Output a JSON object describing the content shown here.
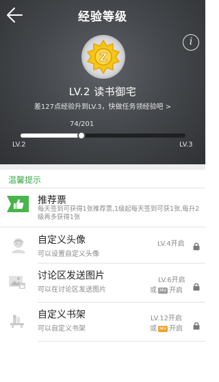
{
  "header": {
    "title": "经验等级",
    "level_name": "LV.2 读书御宅",
    "hint": "差127点经验升到LV.3，快做任务领经验吧 >",
    "progress": {
      "current": 74,
      "total": 201,
      "label": "74/201"
    },
    "from_level": "LV.2",
    "to_level": "LV.3",
    "badge_letter": "Z",
    "info_label": "i"
  },
  "section": {
    "label": "温馨提示"
  },
  "items": [
    {
      "title": "推荐票",
      "desc": "每天签到可获得1张推荐票,1级起每天签到可获1张,每升2级再多获得1张",
      "icon": "thumbs-up-flag-icon"
    },
    {
      "title": "自定义头像",
      "sub": "可以设置自定义头像",
      "unlock_line1": "LV.4开启",
      "icon": "avatar-icon"
    },
    {
      "title": "讨论区发送图片",
      "sub": "可以在讨论区发送图片",
      "unlock_line1": "LV.6开启",
      "unlock_or": "或",
      "unlock_tag": "MV",
      "unlock_suffix": "开启",
      "icon": "image-icon"
    },
    {
      "title": "自定义书架",
      "sub": "可以自定义书架",
      "unlock_line1": "LV.12开启",
      "unlock_or": "或",
      "unlock_tag": "MV",
      "unlock_suffix": "开启",
      "icon": "bookshelf-icon"
    }
  ],
  "colors": {
    "accent_green": "#3aa94a",
    "header_dark": "#3b3e42",
    "badge_gold": "#f5c518",
    "tag_orange": "#f0a020"
  }
}
